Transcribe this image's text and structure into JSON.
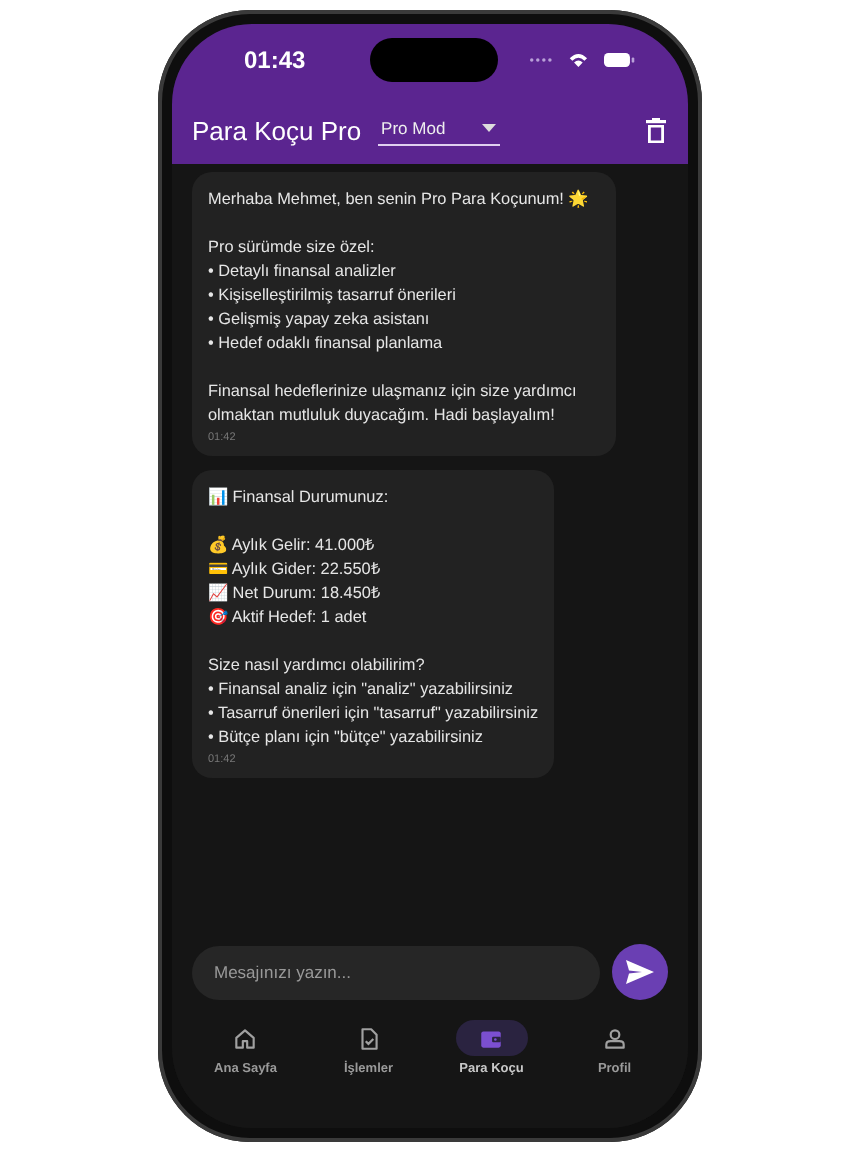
{
  "status_bar": {
    "time": "01:43"
  },
  "app_bar": {
    "title": "Para Koçu Pro",
    "mode_dropdown": {
      "value": "Pro Mod"
    }
  },
  "messages": [
    {
      "text": "Merhaba Mehmet, ben senin Pro Para Koçunum! 🌟\n\nPro sürümde size özel:\n• Detaylı finansal analizler\n• Kişiselleştirilmiş tasarruf önerileri\n• Gelişmiş yapay zeka asistanı\n• Hedef odaklı finansal planlama\n\nFinansal hedeflerinize ulaşmanız için size yardımcı olmaktan mutluluk duyacağım. Hadi başlayalım!",
      "time": "01:42"
    },
    {
      "text": "📊 Finansal Durumunuz:\n\n💰 Aylık Gelir: 41.000₺\n💳 Aylık Gider: 22.550₺\n📈 Net Durum: 18.450₺\n🎯 Aktif Hedef: 1 adet\n\nSize nasıl yardımcı olabilirim?\n• Finansal analiz için \"analiz\" yazabilirsiniz\n• Tasarruf önerileri için \"tasarruf\" yazabilirsiniz\n• Bütçe planı için \"bütçe\" yazabilirsiniz",
      "time": "01:42"
    }
  ],
  "composer": {
    "placeholder": "Mesajınızı yazın..."
  },
  "bottom_nav": [
    {
      "label": "Ana Sayfa",
      "selected": false
    },
    {
      "label": "İşlemler",
      "selected": false
    },
    {
      "label": "Para Koçu",
      "selected": true
    },
    {
      "label": "Profil",
      "selected": false
    }
  ]
}
